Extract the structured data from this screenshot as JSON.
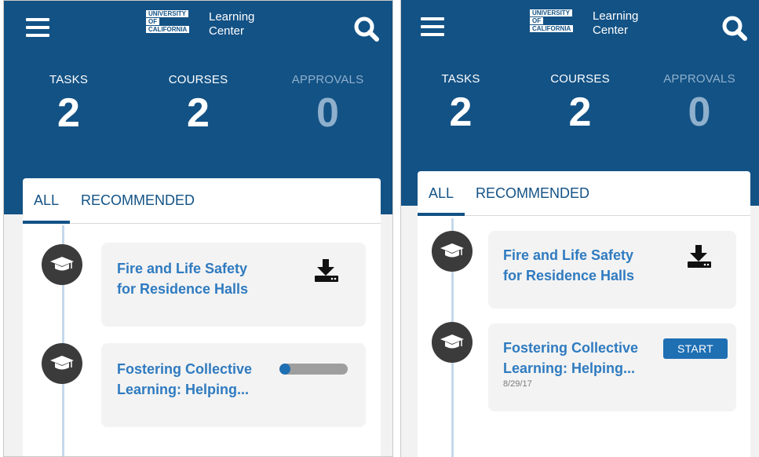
{
  "app": {
    "logo_line1": "UNIVERSITY",
    "logo_line2": "OF",
    "logo_line3": "CALIFORNIA",
    "title_line1": "Learning",
    "title_line2": "Center"
  },
  "stats": {
    "tasks_label": "TASKS",
    "tasks_value": "2",
    "courses_label": "COURSES",
    "courses_value": "2",
    "approvals_label": "APPROVALS",
    "approvals_value": "0"
  },
  "tabs": {
    "all_label": "ALL",
    "recommended_label": "RECOMMENDED"
  },
  "screen1": {
    "item1": {
      "title_line1": "Fire and Life Safety",
      "title_line2": "for Residence Halls"
    },
    "item2": {
      "title_line1": "Fostering Collective",
      "title_line2": "Learning: Helping...",
      "progress": 0.07
    }
  },
  "screen2": {
    "item1": {
      "title_line1": "Fire and Life Safety",
      "title_line2": "for Residence Halls"
    },
    "item2": {
      "title_line1": "Fostering Collective",
      "title_line2": "Learning: Helping...",
      "date": "8/29/17",
      "start_label": "START"
    }
  },
  "colors": {
    "header_bg": "#135285",
    "accent": "#2f7bc0",
    "button": "#1f6fb3",
    "icon_dark": "#3b3b3b"
  },
  "icons": [
    "menu-icon",
    "search-icon",
    "graduation-cap-icon",
    "download-icon"
  ]
}
